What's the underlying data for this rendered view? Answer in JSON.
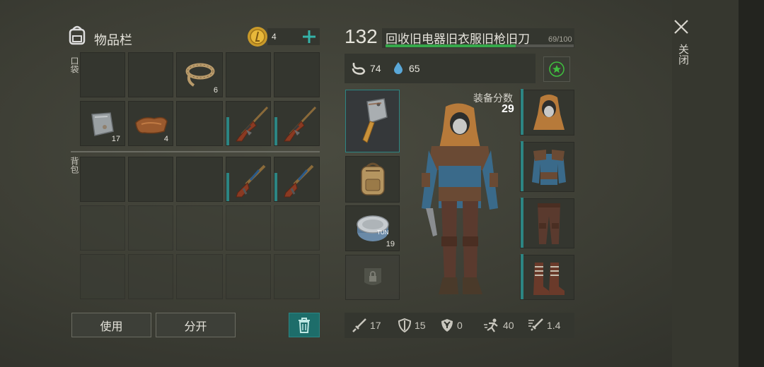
{
  "inventory": {
    "title": "物品栏",
    "coins": "4",
    "pocket_label": "口袋",
    "backpack_label": "背包",
    "items": {
      "rope_count": "6",
      "metal_count": "17",
      "leather_count": "4"
    }
  },
  "actions": {
    "use_label": "使用",
    "split_label": "分开"
  },
  "character": {
    "level": "132",
    "name": "回收旧电器旧衣服旧枪旧刀",
    "xp_text": "69/100",
    "xp_fraction": 0.69,
    "hunger": "74",
    "thirst": "65",
    "gear_score_label": "装备分数",
    "gear_score": "29",
    "tuna_count": "19"
  },
  "stats": {
    "attack": "17",
    "defense": "15",
    "radiation": "0",
    "speed": "40",
    "attack_speed": "1.4"
  },
  "sidebar": {
    "close_label": "关闭"
  },
  "colors": {
    "accent": "#2c8583",
    "xp_bar": "#35a84a",
    "star": "#3fbf3f"
  }
}
